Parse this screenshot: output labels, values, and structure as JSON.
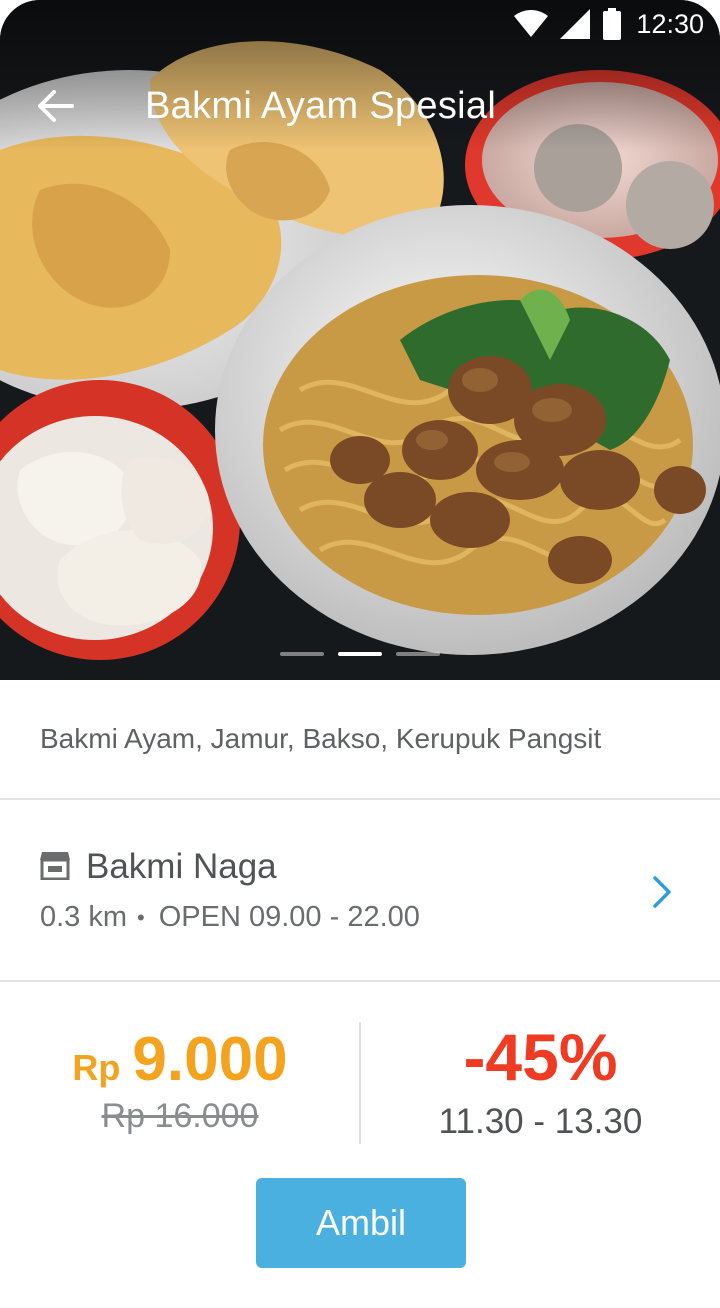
{
  "status_bar": {
    "time": "12:30",
    "icons": [
      "wifi-icon",
      "signal-icon",
      "battery-icon"
    ]
  },
  "app_bar": {
    "back_icon": "arrow-left-icon",
    "title": "Bakmi Ayam Spesial"
  },
  "carousel": {
    "slide_count": 3,
    "active_index": 1
  },
  "description": "Bakmi Ayam, Jamur, Bakso, Kerupuk Pangsit",
  "merchant": {
    "icon": "store-icon",
    "name": "Bakmi Naga",
    "distance": "0.3 km",
    "separator": "•",
    "hours": "OPEN 09.00 - 22.00",
    "chevron_icon": "chevron-right-icon"
  },
  "pricing": {
    "currency": "Rp",
    "price": "9.000",
    "original_price": "Rp 16.000",
    "discount": "-45%",
    "time_window": "11.30 - 13.30"
  },
  "action": {
    "label": "Ambil"
  },
  "colors": {
    "price": "#f4a31e",
    "discount": "#ee3b22",
    "accent": "#4ab0e0",
    "text": "#505254"
  }
}
